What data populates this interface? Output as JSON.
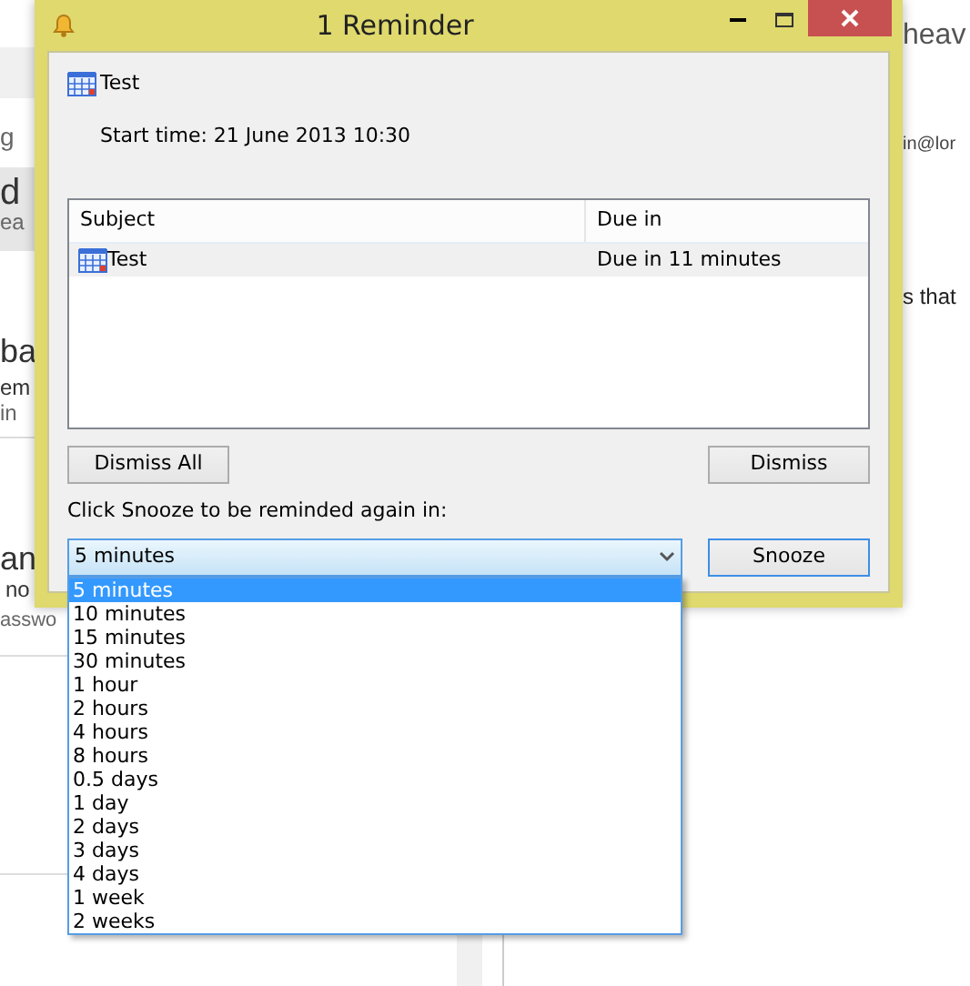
{
  "background": {
    "left_fragments": [
      "g",
      "d",
      "ea",
      "ba",
      "em",
      "in",
      "an",
      "no",
      "asswo"
    ],
    "right_fragments": [
      "heav",
      "in@lor",
      "s that"
    ]
  },
  "window": {
    "title": "1 Reminder"
  },
  "reminder": {
    "subject": "Test",
    "start_time": "Start time: 21 June 2013 10:30"
  },
  "table": {
    "columns": [
      "Subject",
      "Due in"
    ],
    "rows": [
      {
        "subject": "Test",
        "due": "Due in 11 minutes",
        "selected": true
      }
    ]
  },
  "buttons": {
    "dismiss_all": "Dismiss All",
    "dismiss": "Dismiss",
    "snooze": "Snooze"
  },
  "snooze": {
    "label": "Click Snooze to be reminded again in:",
    "value": "5 minutes",
    "expanded": true,
    "options": [
      {
        "label": "5 minutes",
        "selected": true
      },
      {
        "label": "10 minutes",
        "selected": false
      },
      {
        "label": "15 minutes",
        "selected": false
      },
      {
        "label": "30 minutes",
        "selected": false
      },
      {
        "label": "1 hour",
        "selected": false
      },
      {
        "label": "2 hours",
        "selected": false
      },
      {
        "label": "4 hours",
        "selected": false
      },
      {
        "label": "8 hours",
        "selected": false
      },
      {
        "label": "0.5 days",
        "selected": false
      },
      {
        "label": "1 day",
        "selected": false
      },
      {
        "label": "2 days",
        "selected": false
      },
      {
        "label": "3 days",
        "selected": false
      },
      {
        "label": "4 days",
        "selected": false
      },
      {
        "label": "1 week",
        "selected": false
      },
      {
        "label": "2 weeks",
        "selected": false
      }
    ]
  }
}
